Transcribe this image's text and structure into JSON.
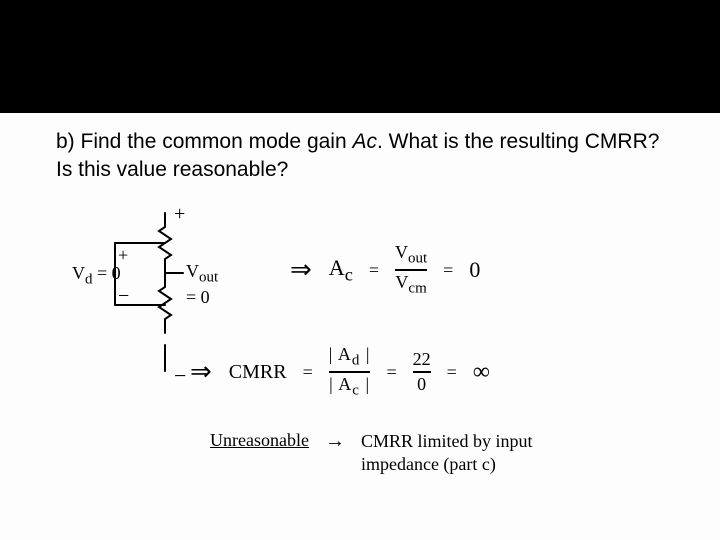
{
  "slide": {
    "question_prefix": "b) Find the common mode gain ",
    "question_var": "Ac",
    "question_suffix": ". What is the resulting CMRR? Is this value reasonable?"
  },
  "schematic": {
    "vd_label": "V",
    "vd_sub": "d",
    "vd_eq": "= 0",
    "vout_label": "V",
    "vout_sub": "out",
    "vout_eq": "= 0",
    "plus": "+",
    "minus": "−"
  },
  "line1": {
    "arrow": "⇒",
    "lhs": "A",
    "lhs_sub": "c",
    "eq": "=",
    "num_v": "V",
    "num_sub": "out",
    "den_v": "V",
    "den_sub": "cm",
    "eq2": "=",
    "result": "0"
  },
  "line2": {
    "arrow": "⇒",
    "name": "CMRR",
    "eq": "=",
    "num": "| A",
    "num_sub": "d",
    "num_end": " |",
    "den": "| A",
    "den_sub": "c",
    "den_end": " |",
    "eq2": "=",
    "val_num": "22",
    "val_den": "0",
    "eq3": "=",
    "result": "∞"
  },
  "note": {
    "lead": "Unreasonable",
    "arrow": "→",
    "rhs1": "CMRR limited by input",
    "rhs2": "impedance (part c)"
  }
}
